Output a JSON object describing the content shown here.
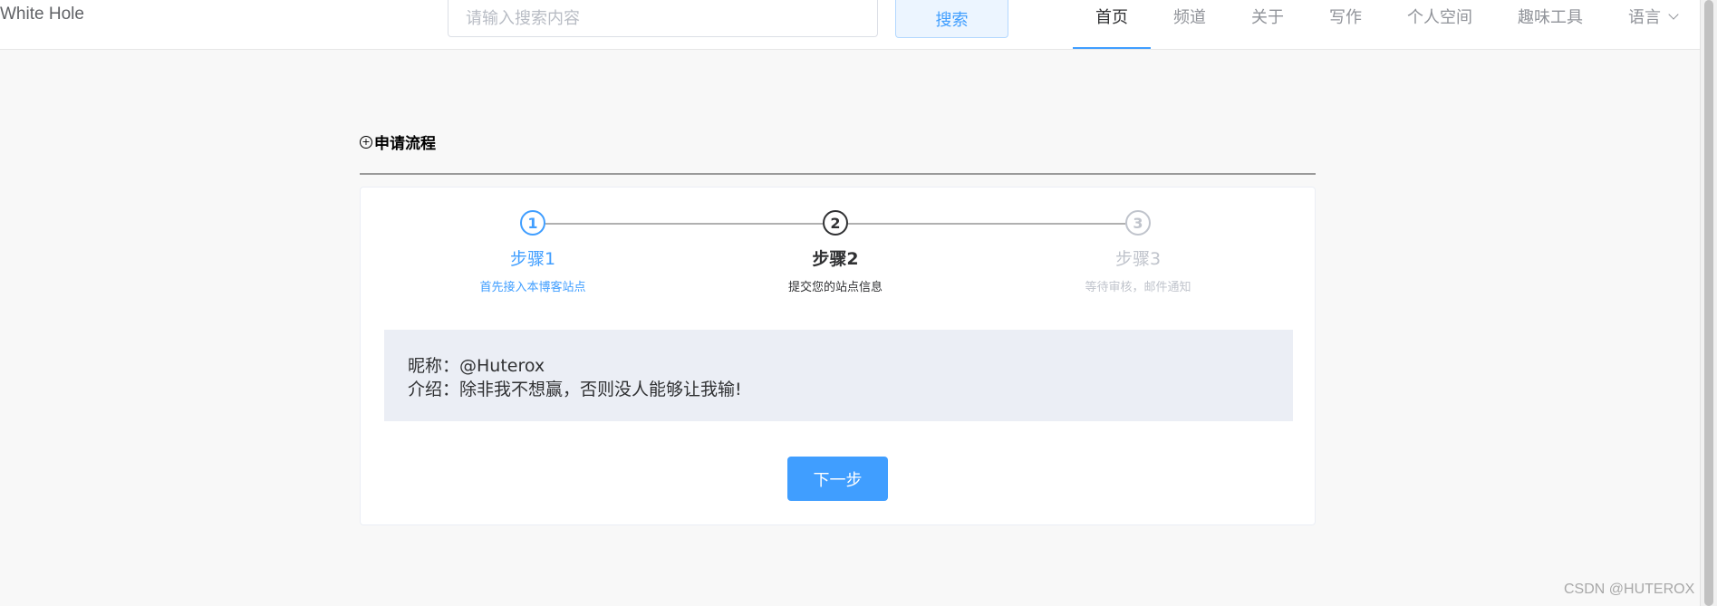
{
  "header": {
    "brand": "White Hole",
    "search_placeholder": "请输入搜索内容",
    "search_button": "搜索",
    "nav": [
      {
        "label": "首页"
      },
      {
        "label": "频道"
      },
      {
        "label": "关于"
      },
      {
        "label": "写作"
      },
      {
        "label": "个人空间"
      },
      {
        "label": "趣味工具"
      },
      {
        "label": "语言"
      }
    ]
  },
  "section": {
    "title": "申请流程",
    "icon": "plus-circle-icon"
  },
  "steps": [
    {
      "number": "1",
      "title": "步骤1",
      "description": "首先接入本博客站点",
      "status": "done"
    },
    {
      "number": "2",
      "title": "步骤2",
      "description": "提交您的站点信息",
      "status": "current"
    },
    {
      "number": "3",
      "title": "步骤3",
      "description": "等待审核，邮件通知",
      "status": "pending"
    }
  ],
  "info": {
    "nickname_label": "昵称：",
    "nickname_value": "@Huterox",
    "intro_label": "介绍：",
    "intro_value": "除非我不想赢，否则没人能够让我输!"
  },
  "next_button": "下一步",
  "watermark": "CSDN @HUTEROX",
  "colors": {
    "primary": "#409eff",
    "info_bg": "#ebeef5",
    "page_bg": "#f8f8f8"
  }
}
